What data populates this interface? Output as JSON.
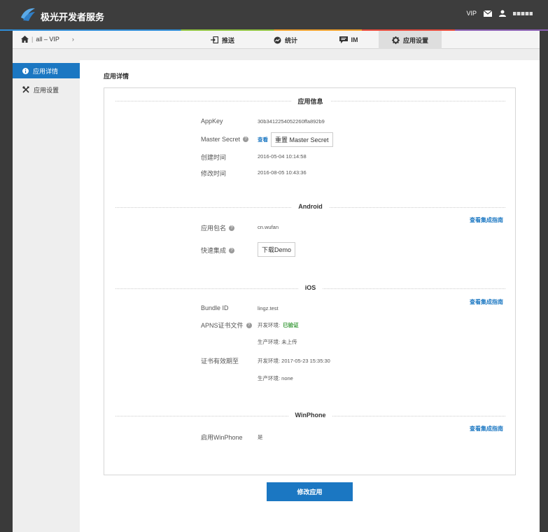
{
  "header": {
    "brand": "极光开发者服务",
    "vip": "VIP",
    "username": " "
  },
  "nav": {
    "breadcrumb_app": "all – VIP",
    "breadcrumb_chevron": "›",
    "tabs": [
      {
        "label": "推送",
        "icon": "push-icon"
      },
      {
        "label": "统计",
        "icon": "chart-icon"
      },
      {
        "label": "IM",
        "icon": "chat-icon"
      },
      {
        "label": "应用设置",
        "icon": "gear-icon"
      }
    ]
  },
  "sidebar": {
    "items": [
      {
        "label": "应用详情",
        "icon": "info-icon",
        "active": true
      },
      {
        "label": "应用设置",
        "icon": "tools-icon",
        "active": false
      }
    ]
  },
  "content": {
    "page_title": "应用详情",
    "app_info": {
      "heading": "应用信息",
      "appkey_label": "AppKey",
      "appkey_value": "30b3412254052260ffa892b9",
      "master_secret_label": "Master Secret",
      "master_secret_view": "查看",
      "master_secret_reset": "重置 Master Secret",
      "created_label": "创建时间",
      "created_value": "2016-05-04 10:14:58",
      "modified_label": "修改时间",
      "modified_value": "2016-08-05 10:43:36"
    },
    "android": {
      "heading": "Android",
      "guide_link": "查看集成指南",
      "package_label": "应用包名",
      "package_value": "cn.wufan",
      "quick_label": "快速集成",
      "quick_button": "下载Demo"
    },
    "ios": {
      "heading": "iOS",
      "guide_link": "查看集成指南",
      "bundle_label": "Bundle ID",
      "bundle_value": "lingz.test",
      "apns_label": "APNS证书文件",
      "apns_dev_prefix": "开发环境:",
      "apns_dev_status": "已验证",
      "apns_prod": "生产环境: 未上传",
      "validity_label": "证书有效期至",
      "validity_dev": "开发环境: 2017-05-23 15:35:30",
      "validity_prod": "生产环境: none"
    },
    "winphone": {
      "heading": "WinPhone",
      "guide_link": "查看集成指南",
      "enable_label": "启用WinPhone",
      "enable_value": "是"
    },
    "submit_button": "修改应用"
  },
  "colors": {
    "topbar": "#3d3d3d",
    "accent_blue": "#1b77c2",
    "verified_green": "#3a9a3a",
    "sidebar_bg": "#eeeeee"
  }
}
